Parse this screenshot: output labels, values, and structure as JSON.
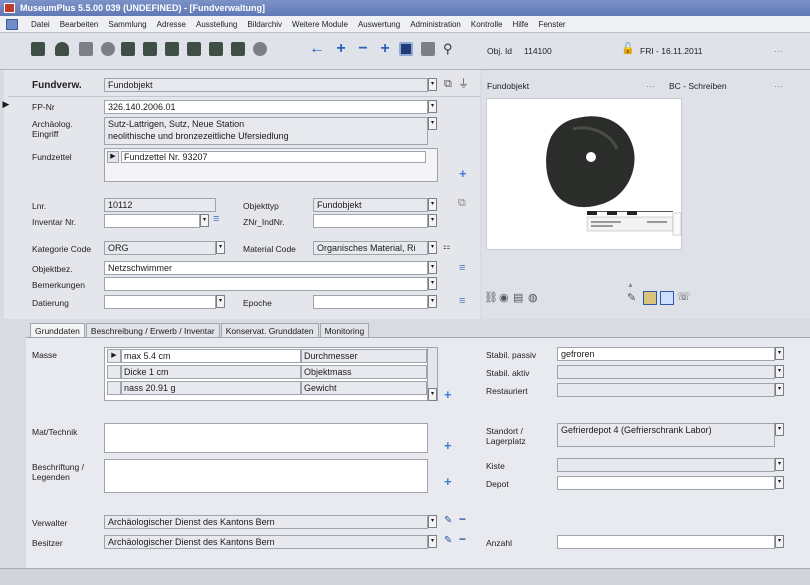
{
  "window": {
    "title": "MuseumPlus 5.5.00 039 (UNDEFINED) - [Fundverwaltung]"
  },
  "menu": [
    "Datei",
    "Bearbeiten",
    "Sammlung",
    "Adresse",
    "Ausstellung",
    "Bildarchiv",
    "Weitere Module",
    "Auswertung",
    "Administration",
    "Kontrolle",
    "Hilfe",
    "Fenster"
  ],
  "toolbar": {
    "obj_id_label": "Obj. Id",
    "obj_id_value": "114100",
    "date": "FRI - 16.11.2011",
    "dots": "···"
  },
  "header": {
    "module_label": "Fundverw.",
    "module_value": "Fundobjekt",
    "right_value": "Fundobjekt",
    "right_dots": "···",
    "right_tab": "BC - Schreiben",
    "right_tab_dots": "···"
  },
  "form": {
    "fp_nr_label": "FP-Nr",
    "fp_nr_value": "326.140.2006.01",
    "archaeolog_label1": "Archäolog.",
    "archaeolog_label2": "Eingriff",
    "archaeolog_value1": "Sutz-Lattrigen, Sutz, Neue Station",
    "archaeolog_value2": "neolithische und bronzezeitliche Ufersiedlung",
    "fundzettel_label": "Fundzettel",
    "fundzettel_value": "Fundzettel Nr. 93207",
    "lnr_label": "Lnr.",
    "lnr_value": "10112",
    "objekttyp_label": "Objekttyp",
    "objekttyp_value": "Fundobjekt",
    "inventar_label": "Inventar Nr.",
    "inventar_value": "",
    "znr_label": "ZNr_IndNr.",
    "znr_value": "",
    "kategorie_label": "Kategorie Code",
    "kategorie_value": "ORG",
    "material_label": "Material Code",
    "material_value": "Organisches Material, Ri",
    "objektbez_label": "Objektbez.",
    "objektbez_value": "Netzschwimmer",
    "bemerkungen_label": "Bemerkungen",
    "bemerkungen_value": "",
    "datierung_label": "Datierung",
    "datierung_value": "",
    "epoche_label": "Epoche",
    "epoche_value": ""
  },
  "tabs": [
    "Grunddaten",
    "Beschreibung / Erwerb / Inventar",
    "Konservat. Grunddaten",
    "Monitoring"
  ],
  "grunddaten": {
    "masse_label": "Masse",
    "masse_rows": [
      {
        "value": "max 5.4 cm",
        "type": "Durchmesser"
      },
      {
        "value": "Dicke 1 cm",
        "type": "Objektmass"
      },
      {
        "value": "nass 20.91 g",
        "type": "Gewicht"
      }
    ],
    "mattechnik_label": "Mat/Technik",
    "beschriftung_label1": "Beschriftung /",
    "beschriftung_label2": "Legenden",
    "verwalter_label": "Verwalter",
    "verwalter_value": "Archäologischer Dienst des Kantons Bern",
    "besitzer_label": "Besitzer",
    "besitzer_value": "Archäologischer Dienst des Kantons Bern",
    "stabil_passiv_label": "Stabil. passiv",
    "stabil_passiv_value": "gefroren",
    "stabil_aktiv_label": "Stabil. aktiv",
    "stabil_aktiv_value": "",
    "restauriert_label": "Restauriert",
    "restauriert_value": "",
    "standort_label1": "Standort /",
    "standort_label2": "Lagerplatz",
    "standort_value": "Gefrierdepot 4 (Gefrierschrank Labor)",
    "kiste_label": "Kiste",
    "kiste_value": "",
    "depot_label": "Depot",
    "depot_value": "",
    "anzahl_label": "Anzahl",
    "anzahl_value": ""
  },
  "colors": {
    "titlebar": "#6a82bd",
    "accent": "#2c5da8"
  }
}
